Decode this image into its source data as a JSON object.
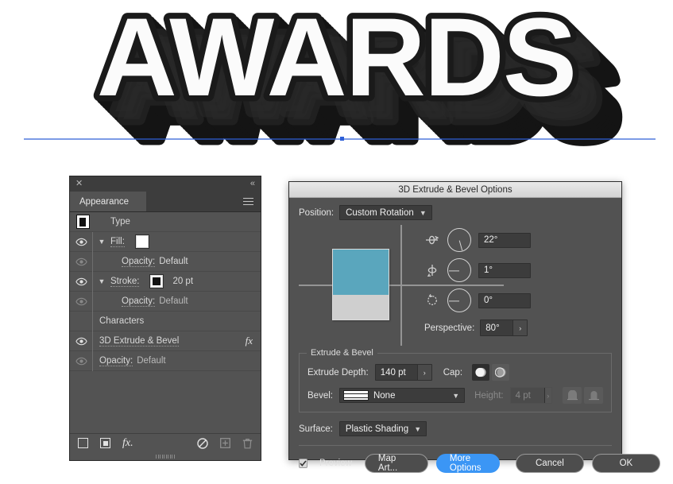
{
  "artwork": {
    "text": "AWARDS",
    "fill_color": "#fbfbfb",
    "stroke_color": "#1a1a1a",
    "extrude_color": "#141414",
    "guide_color": "#2d5fd8"
  },
  "appearance_panel": {
    "tab_label": "Appearance",
    "close_icon": "✕",
    "collapse_icon": "«",
    "menu_icon": "hamburger-icon",
    "rows": [
      {
        "label": "Type",
        "kind": "type"
      },
      {
        "label": "Fill:",
        "kind": "fill",
        "eye": "on"
      },
      {
        "label": "Opacity:",
        "value": "Default",
        "kind": "opacity",
        "eye": "off"
      },
      {
        "label": "Stroke:",
        "value": "20 pt",
        "kind": "stroke",
        "eye": "on"
      },
      {
        "label": "Opacity:",
        "value": "Default",
        "kind": "opacity",
        "eye": "off"
      },
      {
        "label": "Characters",
        "kind": "plain"
      },
      {
        "label": "3D Extrude & Bevel",
        "kind": "effect",
        "eye": "on",
        "fx": "fx"
      },
      {
        "label": "Opacity:",
        "value": "Default",
        "kind": "opacity",
        "eye": "off"
      }
    ],
    "footer_icons": [
      "new-fill-icon",
      "new-stroke-icon",
      "add-effect-icon",
      "clear-appearance-icon",
      "duplicate-item-icon",
      "delete-item-icon"
    ]
  },
  "dialog": {
    "title": "3D Extrude & Bevel Options",
    "position": {
      "label": "Position:",
      "value": "Custom Rotation",
      "rotations": [
        {
          "axis_icon": "rotate-x-icon",
          "value": "22°",
          "angle_deg": 22
        },
        {
          "axis_icon": "rotate-y-icon",
          "value": "1°",
          "angle_deg": 1
        },
        {
          "axis_icon": "rotate-z-icon",
          "value": "0°",
          "angle_deg": 0
        }
      ],
      "perspective_label": "Perspective:",
      "perspective_value": "80°",
      "cube_top_color": "#5aa6bd",
      "cube_bottom_color": "#cfcfcf"
    },
    "extrude_bevel": {
      "legend": "Extrude & Bevel",
      "depth_label": "Extrude Depth:",
      "depth_value": "140 pt",
      "cap_label": "Cap:",
      "cap_selected_index": 0,
      "bevel_label": "Bevel:",
      "bevel_value": "None",
      "height_label": "Height:",
      "height_value": "4 pt",
      "height_disabled": true
    },
    "surface": {
      "label": "Surface:",
      "value": "Plastic Shading"
    },
    "buttons": {
      "preview_label": "Preview",
      "preview_checked": true,
      "map_art_label": "Map Art...",
      "more_options_label": "More Options",
      "cancel_label": "Cancel",
      "ok_label": "OK",
      "primary_color": "#3b96f5"
    }
  }
}
